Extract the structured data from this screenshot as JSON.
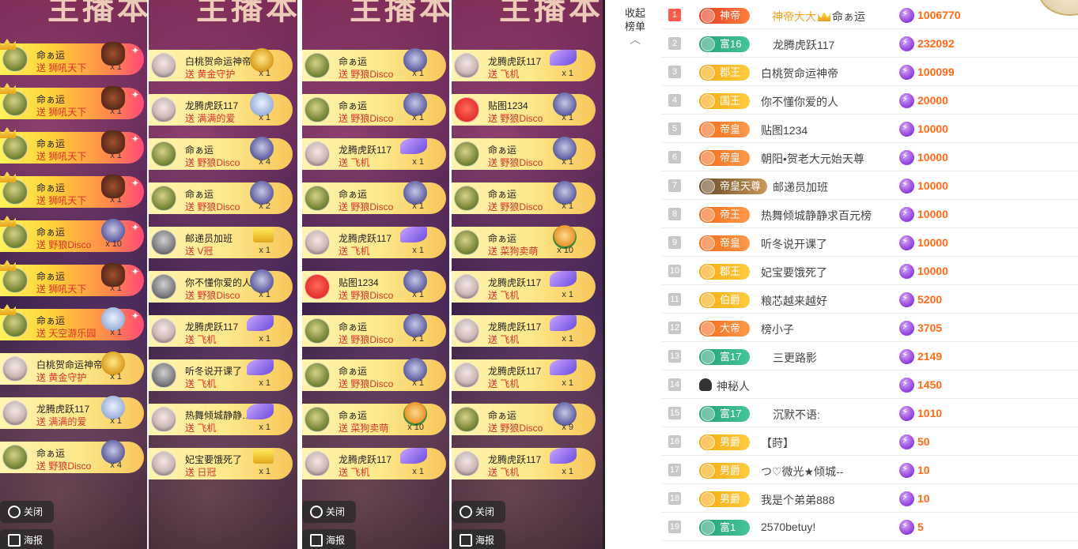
{
  "columns": [
    {
      "title": "主播本",
      "rows": [
        {
          "style": "hot",
          "avatar": "cat",
          "crown": true,
          "sender": "命ぁ运",
          "gift": "送 狮吼天下",
          "count": "x 1",
          "icon": "lion"
        },
        {
          "style": "hot",
          "avatar": "cat",
          "crown": true,
          "sender": "命ぁ运",
          "gift": "送 狮吼天下",
          "count": "x 1",
          "icon": "lion"
        },
        {
          "style": "hot",
          "avatar": "cat",
          "crown": true,
          "sender": "命ぁ运",
          "gift": "送 狮吼天下",
          "count": "x 1",
          "icon": "lion"
        },
        {
          "style": "hot",
          "avatar": "cat",
          "crown": true,
          "sender": "命ぁ运",
          "gift": "送 狮吼天下",
          "count": "x 1",
          "icon": "lion"
        },
        {
          "style": "hot",
          "avatar": "cat",
          "crown": true,
          "sender": "命ぁ运",
          "gift": "送 野狼Disco",
          "count": "x 10",
          "icon": "wolf"
        },
        {
          "style": "hot",
          "avatar": "cat",
          "crown": true,
          "sender": "命ぁ运",
          "gift": "送 狮吼天下",
          "count": "x 1",
          "icon": "lion"
        },
        {
          "style": "hot",
          "avatar": "cat",
          "crown": true,
          "sender": "命ぁ运",
          "gift": "送 天空游乐园",
          "count": "x 1",
          "icon": "park"
        },
        {
          "style": "plain",
          "avatar": "girl",
          "crown": false,
          "sender": "白桃贺命运神帝",
          "gift": "送 黄金守护",
          "count": "x 1",
          "icon": "gold"
        },
        {
          "style": "plain",
          "avatar": "girl",
          "crown": false,
          "sender": "龙腾虎跃117",
          "gift": "送 满满的爱",
          "count": "x 1",
          "icon": "park"
        },
        {
          "style": "plain",
          "avatar": "cat",
          "crown": false,
          "sender": "命ぁ运",
          "gift": "送 野狼Disco",
          "count": "x 4",
          "icon": "wolf"
        }
      ],
      "buttons": [
        "关闭",
        "海报"
      ]
    },
    {
      "title": "主播本",
      "rows": [
        {
          "style": "plain",
          "avatar": "girl",
          "crown": false,
          "sender": "白桃贺命运神帝",
          "gift": "送 黄金守护",
          "count": "x 1",
          "icon": "gold"
        },
        {
          "style": "plain",
          "avatar": "girl",
          "crown": false,
          "sender": "龙腾虎跃117",
          "gift": "送 满满的爱",
          "count": "x 1",
          "icon": "park"
        },
        {
          "style": "plain",
          "avatar": "cat",
          "crown": false,
          "sender": "命ぁ运",
          "gift": "送 野狼Disco",
          "count": "x 4",
          "icon": "wolf"
        },
        {
          "style": "plain",
          "avatar": "cat",
          "crown": false,
          "sender": "命ぁ运",
          "gift": "送 野狼Disco",
          "count": "x 2",
          "icon": "wolf"
        },
        {
          "style": "plain",
          "avatar": "gray",
          "crown": false,
          "sender": "邮递员加班",
          "gift": "送 V冠",
          "count": "x 1",
          "icon": "vcrown"
        },
        {
          "style": "plain",
          "avatar": "gray",
          "crown": false,
          "sender": "你不懂你爱的人",
          "gift": "送 野狼Disco",
          "count": "x 1",
          "icon": "wolf"
        },
        {
          "style": "plain",
          "avatar": "girl",
          "crown": false,
          "sender": "龙腾虎跃117",
          "gift": "送 飞机",
          "count": "x 1",
          "icon": "plane"
        },
        {
          "style": "plain",
          "avatar": "gray",
          "crown": false,
          "sender": "听冬说开课了",
          "gift": "送 飞机",
          "count": "x 1",
          "icon": "plane"
        },
        {
          "style": "plain",
          "avatar": "girl",
          "crown": false,
          "sender": "热舞倾城静静…",
          "gift": "送 飞机",
          "count": "x 1",
          "icon": "plane"
        },
        {
          "style": "plain",
          "avatar": "girl",
          "crown": false,
          "sender": "妃宝要饿死了",
          "gift": "送 日冠",
          "count": "x 1",
          "icon": "vcrown"
        }
      ],
      "buttons": []
    },
    {
      "title": "主播本",
      "rows": [
        {
          "style": "plain",
          "avatar": "cat",
          "crown": false,
          "sender": "命ぁ运",
          "gift": "送 野狼Disco",
          "count": "x 1",
          "icon": "wolf"
        },
        {
          "style": "plain",
          "avatar": "cat",
          "crown": false,
          "sender": "命ぁ运",
          "gift": "送 野狼Disco",
          "count": "x 1",
          "icon": "wolf"
        },
        {
          "style": "plain",
          "avatar": "girl",
          "crown": false,
          "sender": "龙腾虎跃117",
          "gift": "送 飞机",
          "count": "x 1",
          "icon": "plane"
        },
        {
          "style": "plain",
          "avatar": "cat",
          "crown": false,
          "sender": "命ぁ运",
          "gift": "送 野狼Disco",
          "count": "x 1",
          "icon": "wolf"
        },
        {
          "style": "plain",
          "avatar": "girl",
          "crown": false,
          "sender": "龙腾虎跃117",
          "gift": "送 飞机",
          "count": "x 1",
          "icon": "plane"
        },
        {
          "style": "plain",
          "avatar": "red",
          "crown": false,
          "sender": "贴图1234",
          "gift": "送 野狼Disco",
          "count": "x 1",
          "icon": "wolf"
        },
        {
          "style": "plain",
          "avatar": "cat",
          "crown": false,
          "sender": "命ぁ运",
          "gift": "送 野狼Disco",
          "count": "x 1",
          "icon": "wolf"
        },
        {
          "style": "plain",
          "avatar": "cat",
          "crown": false,
          "sender": "命ぁ运",
          "gift": "送 野狼Disco",
          "count": "x 1",
          "icon": "wolf"
        },
        {
          "style": "plain",
          "avatar": "cat",
          "crown": false,
          "sender": "命ぁ运",
          "gift": "送 菜狗卖萌",
          "count": "x 10",
          "icon": "dog"
        },
        {
          "style": "plain",
          "avatar": "girl",
          "crown": false,
          "sender": "龙腾虎跃117",
          "gift": "送 飞机",
          "count": "x 1",
          "icon": "plane"
        }
      ],
      "buttons": [
        "关闭",
        "海报"
      ]
    },
    {
      "title": "主播本",
      "rows": [
        {
          "style": "plain",
          "avatar": "girl",
          "crown": false,
          "sender": "龙腾虎跃117",
          "gift": "送 飞机",
          "count": "x 1",
          "icon": "plane"
        },
        {
          "style": "plain",
          "avatar": "red",
          "crown": false,
          "sender": "贴图1234",
          "gift": "送 野狼Disco",
          "count": "x 1",
          "icon": "wolf"
        },
        {
          "style": "plain",
          "avatar": "cat",
          "crown": false,
          "sender": "命ぁ运",
          "gift": "送 野狼Disco",
          "count": "x 1",
          "icon": "wolf"
        },
        {
          "style": "plain",
          "avatar": "cat",
          "crown": false,
          "sender": "命ぁ运",
          "gift": "送 野狼Disco",
          "count": "x 1",
          "icon": "wolf"
        },
        {
          "style": "plain",
          "avatar": "cat",
          "crown": false,
          "sender": "命ぁ运",
          "gift": "送 菜狗卖萌",
          "count": "x 10",
          "icon": "dog"
        },
        {
          "style": "plain",
          "avatar": "girl",
          "crown": false,
          "sender": "龙腾虎跃117",
          "gift": "送 飞机",
          "count": "x 1",
          "icon": "plane"
        },
        {
          "style": "plain",
          "avatar": "girl",
          "crown": false,
          "sender": "龙腾虎跃117",
          "gift": "送 飞机",
          "count": "x 1",
          "icon": "plane"
        },
        {
          "style": "plain",
          "avatar": "girl",
          "crown": false,
          "sender": "龙腾虎跃117",
          "gift": "送 飞机",
          "count": "x 1",
          "icon": "plane"
        },
        {
          "style": "plain",
          "avatar": "cat",
          "crown": false,
          "sender": "命ぁ运",
          "gift": "送 野狼Disco",
          "count": "x 9",
          "icon": "wolf"
        },
        {
          "style": "plain",
          "avatar": "girl",
          "crown": false,
          "sender": "龙腾虎跃117",
          "gift": "送 飞机",
          "count": "x 1",
          "icon": "plane"
        }
      ],
      "buttons": [
        "关闭",
        "海报"
      ]
    }
  ],
  "ranking": {
    "collapse_label": "收起榜单",
    "rows": [
      {
        "rank": "1",
        "badge": "神帝",
        "badge_color": "red",
        "name": "神帝大大",
        "name_suffix": "命ぁ运",
        "highlight": true,
        "value": "1006770"
      },
      {
        "rank": "2",
        "badge": "富16",
        "badge_color": "teal",
        "name": "龙腾虎跃117",
        "value": "232092"
      },
      {
        "rank": "3",
        "badge": "郡王",
        "badge_color": "gold",
        "name": "白桃贺命运神帝",
        "value": "100099"
      },
      {
        "rank": "4",
        "badge": "国王",
        "badge_color": "gold",
        "name": "你不懂你爱的人",
        "value": "20000"
      },
      {
        "rank": "5",
        "badge": "帝皇",
        "badge_color": "orange",
        "name": "贴图1234",
        "value": "10000"
      },
      {
        "rank": "6",
        "badge": "帝皇",
        "badge_color": "orange",
        "name": "朝阳•贺老大元始天尊",
        "value": "10000"
      },
      {
        "rank": "7",
        "badge": "帝皇天尊",
        "badge_color": "dark",
        "name": "邮递员加班",
        "value": "10000"
      },
      {
        "rank": "8",
        "badge": "帝王",
        "badge_color": "orange",
        "name": "热舞倾城静静求百元榜",
        "value": "10000"
      },
      {
        "rank": "9",
        "badge": "帝皇",
        "badge_color": "orange",
        "name": "听冬说开课了",
        "value": "10000"
      },
      {
        "rank": "10",
        "badge": "郡王",
        "badge_color": "gold",
        "name": "妃宝要饿死了",
        "value": "10000"
      },
      {
        "rank": "11",
        "badge": "伯爵",
        "badge_color": "gold",
        "name": "粮芯越来越好",
        "value": "5200"
      },
      {
        "rank": "12",
        "badge": "大帝",
        "badge_color": "orange",
        "name": "榜小子",
        "value": "3705"
      },
      {
        "rank": "13",
        "badge": "富17",
        "badge_color": "teal",
        "name": "三更路影",
        "value": "2149"
      },
      {
        "rank": "14",
        "badge": "",
        "badge_color": "none",
        "name": "神秘人",
        "value": "1450"
      },
      {
        "rank": "15",
        "badge": "富17",
        "badge_color": "teal",
        "name": "沉默不语:",
        "value": "1010"
      },
      {
        "rank": "16",
        "badge": "男爵",
        "badge_color": "gold",
        "name": "【莳】",
        "value": "50"
      },
      {
        "rank": "17",
        "badge": "男爵",
        "badge_color": "gold",
        "name": "つ♡微光★倾城--",
        "value": "10"
      },
      {
        "rank": "18",
        "badge": "男爵",
        "badge_color": "gold",
        "name": "我是个弟弟888",
        "value": "10"
      },
      {
        "rank": "19",
        "badge": "富1",
        "badge_color": "teal",
        "name": "2570betuy!",
        "value": "5"
      }
    ]
  }
}
